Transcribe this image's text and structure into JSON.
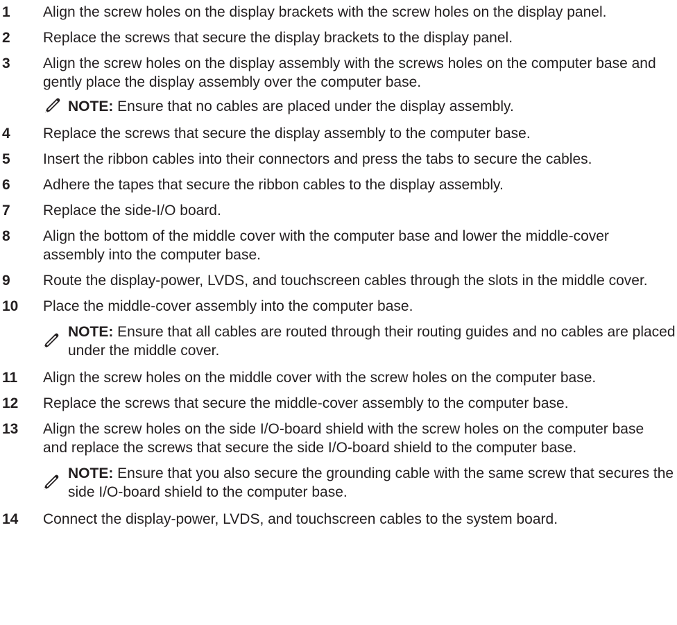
{
  "icons": {
    "note_icon": "pencil-icon"
  },
  "steps": [
    {
      "num": "1",
      "text": "Align the screw holes on the display brackets with the screw holes on the display panel."
    },
    {
      "num": "2",
      "text": "Replace the screws that secure the display brackets to the display panel."
    },
    {
      "num": "3",
      "text": "Align the screw holes on the display assembly with the screws holes on the computer base and gently place the display assembly over the computer base."
    },
    {
      "num": "4",
      "text": "Replace the screws that secure the display assembly to the computer base."
    },
    {
      "num": "5",
      "text": "Insert the ribbon cables into their connectors and press the tabs to secure the cables."
    },
    {
      "num": "6",
      "text": "Adhere the tapes that secure the ribbon cables to the display assembly."
    },
    {
      "num": "7",
      "text": "Replace the side-I/O board."
    },
    {
      "num": "8",
      "text": "Align the bottom of the middle cover with the computer base and lower the middle-cover assembly into the computer base."
    },
    {
      "num": "9",
      "text": "Route the display-power, LVDS, and touchscreen cables through the slots in the middle cover."
    },
    {
      "num": "10",
      "text": "Place the middle-cover assembly into the computer base."
    },
    {
      "num": "11",
      "text": "Align the screw holes on the middle cover with the screw holes on the computer base."
    },
    {
      "num": "12",
      "text": "Replace the screws that secure the middle-cover assembly to the computer base."
    },
    {
      "num": "13",
      "text": "Align the screw holes on the side I/O-board shield with the screw holes on the computer base and replace the screws that secure the side I/O-board shield to the computer base."
    },
    {
      "num": "14",
      "text": "Connect the display-power, LVDS, and touchscreen cables to the system board."
    }
  ],
  "notes": [
    {
      "label": "NOTE:",
      "text": " Ensure that no cables are placed under the display assembly."
    },
    {
      "label": "NOTE:",
      "text": " Ensure that all cables are routed through their routing guides and no cables are placed under the middle cover."
    },
    {
      "label": "NOTE:",
      "text": " Ensure that you also secure the grounding cable with the same screw that secures the side I/O-board shield to the computer base."
    }
  ]
}
